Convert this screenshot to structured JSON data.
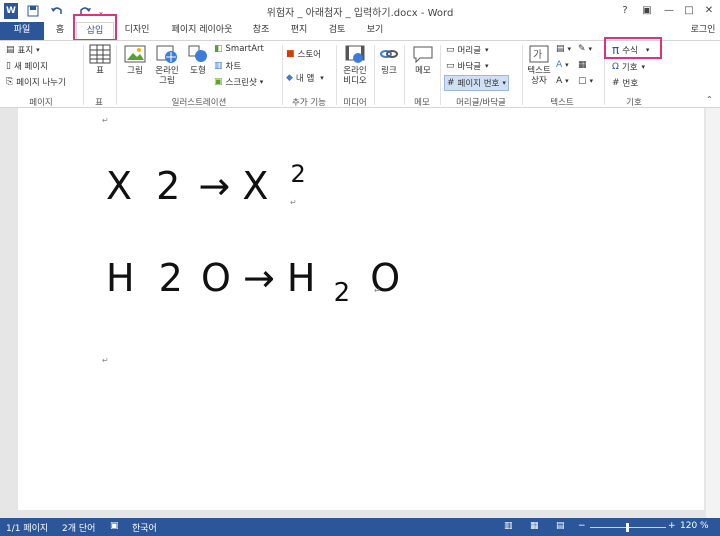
{
  "title": "위험자 _ 아래첨자 _ 입력하기.docx - Word",
  "quick_access": {
    "word_icon": "W",
    "save_icon": "save",
    "undo_icon": "undo",
    "redo_icon": "redo",
    "customize_icon": "customize"
  },
  "window_controls": {
    "help": "?",
    "ribbon_options": "▣",
    "minimize": "—",
    "restore": "□",
    "close": "✕"
  },
  "tabs": [
    {
      "label": "파일"
    },
    {
      "label": "홈"
    },
    {
      "label": "삽입"
    },
    {
      "label": "디자인"
    },
    {
      "label": "페이지 레이아웃"
    },
    {
      "label": "참조"
    },
    {
      "label": "편지"
    },
    {
      "label": "검토"
    },
    {
      "label": "보기"
    }
  ],
  "signin": "로그인",
  "ribbon": {
    "pages": {
      "cover": "표지",
      "blank": "새 페이지",
      "break": "페이지 나누기",
      "label": "페이지"
    },
    "table": {
      "btn": "표",
      "label": "표"
    },
    "illustrations": {
      "picture": "그림",
      "online1": "온라인",
      "online2": "그림",
      "shapes": "도형",
      "smartart": "SmartArt",
      "chart": "차트",
      "screenshot": "스크린샷",
      "label": "일러스트레이션"
    },
    "addins": {
      "store": "스토어",
      "myapps": "내 앱",
      "label": "추가 기능"
    },
    "media": {
      "v1": "온라인",
      "v2": "비디오",
      "label": "미디어"
    },
    "links": {
      "btn": "링크",
      "label": ""
    },
    "comments": {
      "btn": "메모",
      "label": "메모"
    },
    "header_footer": {
      "header": "머리글",
      "footer": "바닥글",
      "page_number": "페이지 번호",
      "label": "머리글/바닥글"
    },
    "text": {
      "t1": "텍스트",
      "t2": "상자",
      "label": "텍스트"
    },
    "symbols": {
      "equation": "수식",
      "symbol": "기호",
      "number": "번호",
      "label": "기호"
    }
  },
  "document": {
    "line1": {
      "a": "X",
      "b": "2",
      "arrow": "→",
      "c": "X",
      "sup": "2"
    },
    "line2": {
      "a": "H",
      "b": "2",
      "c": "O",
      "arrow": "→",
      "d": "H",
      "sub": "2",
      "e": "O"
    },
    "para_mark": "↵"
  },
  "status": {
    "page": "1/1 페이지",
    "words": "2개 단어",
    "lang": "한국어",
    "zoom": "120 %"
  },
  "colors": {
    "accent": "#2b579a",
    "highlight": "#e0317e"
  }
}
